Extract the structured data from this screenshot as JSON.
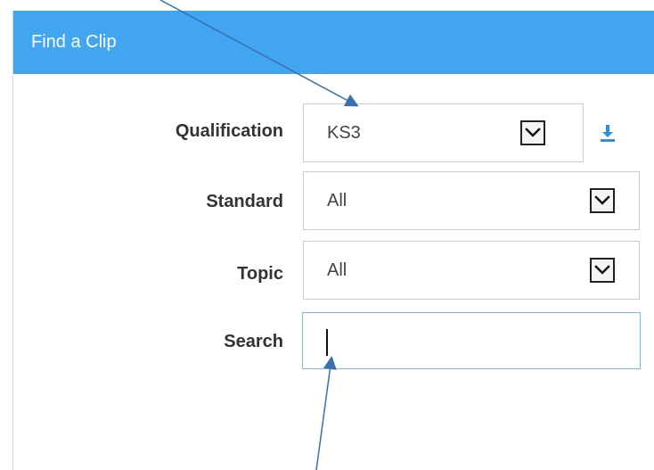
{
  "panel": {
    "title": "Find a Clip",
    "header_color": "#42a5f0"
  },
  "form": {
    "qualification": {
      "label": "Qualification",
      "value": "KS3"
    },
    "standard": {
      "label": "Standard",
      "value": "All"
    },
    "topic": {
      "label": "Topic",
      "value": "All"
    },
    "search": {
      "label": "Search",
      "value": "",
      "placeholder": ""
    }
  },
  "icons": {
    "download": "download-icon",
    "dropdown": "chevron-down-icon"
  },
  "annotations": {
    "arrow_color": "#3a6fb0"
  }
}
